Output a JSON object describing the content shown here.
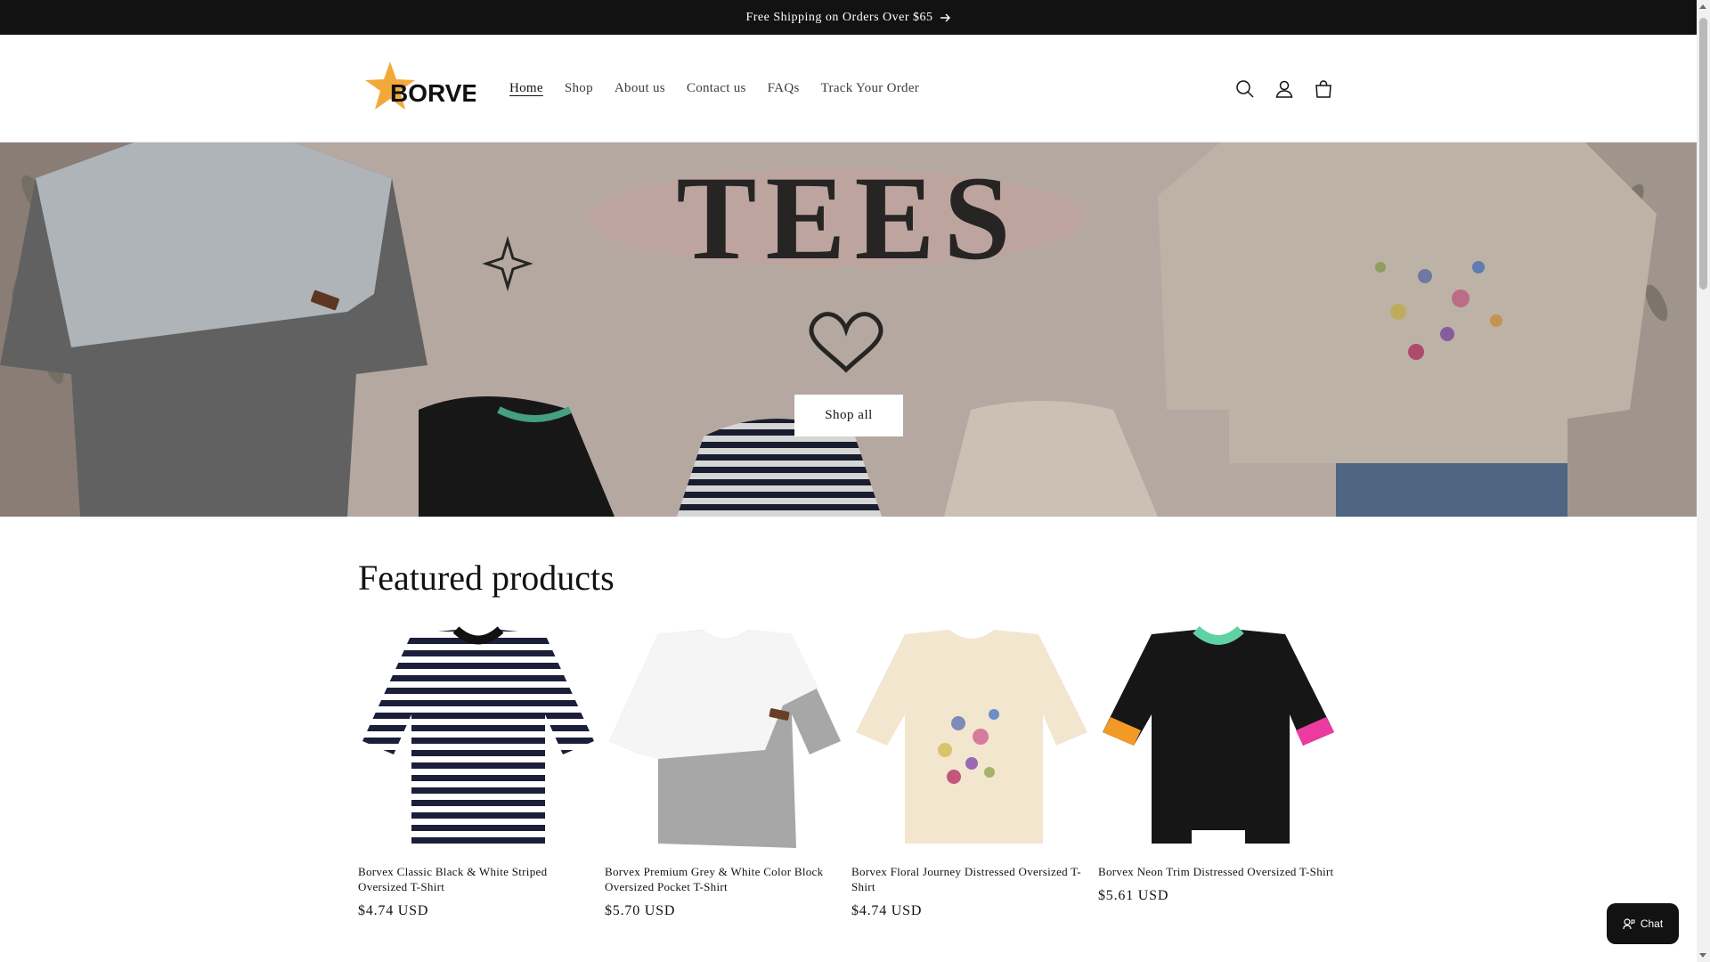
{
  "announcement": {
    "text": "Free Shipping on Orders Over $65"
  },
  "brand": {
    "name": "BORVEX",
    "accent": "#f2a93b"
  },
  "nav": [
    {
      "label": "Home",
      "active": true
    },
    {
      "label": "Shop"
    },
    {
      "label": "About us"
    },
    {
      "label": "Contact us"
    },
    {
      "label": "FAQs"
    },
    {
      "label": "Track Your Order"
    }
  ],
  "header_icons": [
    "search-icon",
    "account-icon",
    "cart-icon"
  ],
  "hero": {
    "heading": "TEES",
    "button": "Shop all"
  },
  "featured": {
    "title": "Featured products",
    "products": [
      {
        "title": "Borvex Classic Black & White Striped Oversized T-Shirt",
        "price": "$4.74 USD"
      },
      {
        "title": "Borvex Premium Grey & White Color Block Oversized Pocket T-Shirt",
        "price": "$5.70 USD"
      },
      {
        "title": "Borvex Floral Journey Distressed Oversized T-Shirt",
        "price": "$4.74 USD"
      },
      {
        "title": "Borvex Neon Trim Distressed Oversized T-Shirt",
        "price": "$5.61 USD"
      }
    ]
  },
  "chat": {
    "label": "Chat"
  }
}
